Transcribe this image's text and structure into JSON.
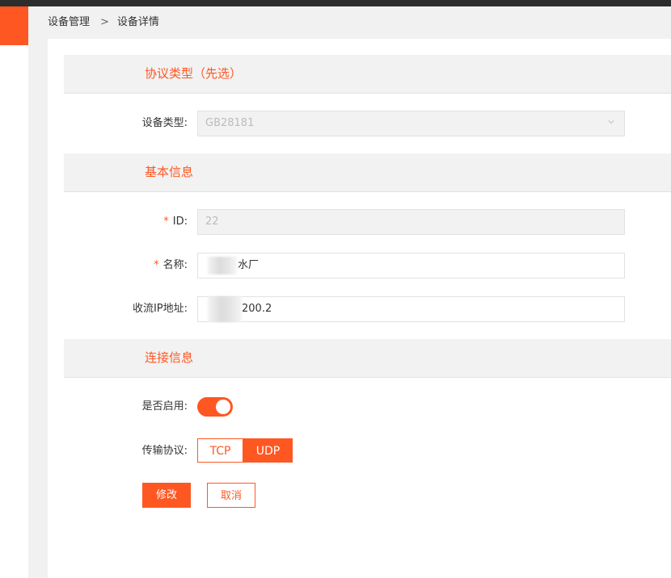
{
  "breadcrumb": {
    "parent": "设备管理",
    "separator": ">",
    "current": "设备详情"
  },
  "sections": {
    "protocol": {
      "title": "协议类型（先选）"
    },
    "basic": {
      "title": "基本信息"
    },
    "connection": {
      "title": "连接信息"
    }
  },
  "form": {
    "device_type": {
      "label": "设备类型:",
      "value": "GB28181",
      "disabled": true
    },
    "id": {
      "label": "ID:",
      "required_mark": "*",
      "value": "22",
      "disabled": true
    },
    "name": {
      "label": "名称:",
      "required_mark": "*",
      "value_visible": "水厂"
    },
    "stream_ip": {
      "label": "收流IP地址:",
      "value_visible": "200.2"
    },
    "enabled": {
      "label": "是否启用:",
      "on": true
    },
    "transport": {
      "label": "传输协议:",
      "options": [
        "TCP",
        "UDP"
      ],
      "selected": "UDP"
    }
  },
  "actions": {
    "modify": "修改",
    "cancel": "取消"
  },
  "colors": {
    "accent": "#ff5722",
    "topbar": "#2d2d2d",
    "section_bg": "#f2f2f2"
  },
  "icons": {
    "select_arrow": "chevron-down-icon"
  }
}
